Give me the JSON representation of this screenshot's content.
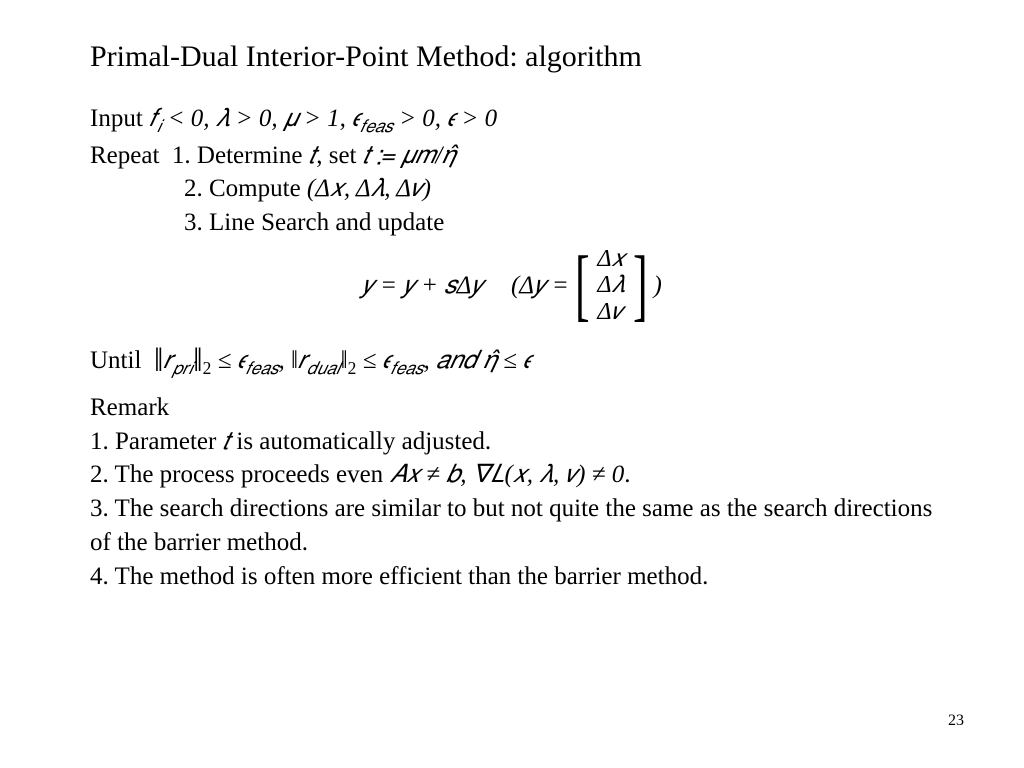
{
  "title": "Primal-Dual Interior-Point Method: algorithm",
  "input_label": "Input",
  "input_math": "𝑓<sub class='sub'>𝑖</sub> &lt; 0, 𝜆 &gt; 0, 𝜇 &gt; 1, 𝜖<sub class='sub'>𝑓𝑒𝑎𝑠</sub> &gt; 0, 𝜖 &gt; 0",
  "repeat_label": "Repeat",
  "step1_pre": "1. Determine ",
  "step1_mid": ", set ",
  "step1_t": "𝑡",
  "step1_assign": "𝑡 ≔ 𝜇𝑚/𝜂̂",
  "step2": "2. Compute (Δ𝑥, Δ𝜆, Δ𝑣)",
  "step3": "3. Line Search and update",
  "eq_left": "𝑦 = 𝑦 + 𝑠Δ𝑦",
  "eq_gap": "   ",
  "eq_right_open": "(Δ𝑦 =",
  "eq_right_close": ")",
  "vec1": "Δ𝑥",
  "vec2": "Δ𝜆",
  "vec3": "Δ𝑣",
  "until_label": "Until",
  "until_math": "<span class='bignorm'>‖</span>𝑟<sub class='sub'>𝑝𝑟𝑖</sub><span class='bignorm'>‖</span><sub class='sub' style='font-style:normal'>2</sub> ≤ 𝜖<sub class='sub'>𝑓𝑒𝑎𝑠</sub>, <span class='norm'>‖</span>𝑟<sub class='sub'>𝑑𝑢𝑎𝑙</sub><span class='norm'>‖</span><sub class='sub' style='font-style:normal'>2</sub> ≤ 𝜖<sub class='sub'>𝑓𝑒𝑎𝑠</sub>, 𝑎𝑛𝑑  𝜂̂ ≤ 𝜖",
  "remark_label": "Remark",
  "remark1_pre": "1.  Parameter ",
  "remark1_t": "𝑡",
  "remark1_post": " is automatically adjusted.",
  "remark2_pre": "2. The process proceeds even ",
  "remark2_math": "𝐴𝑥 ≠ 𝑏, ∇𝐿(𝑥, 𝜆, 𝑣) ≠ 0",
  "remark2_post": ".",
  "remark3": "3. The search directions are similar to but not quite the same as the search directions of the barrier method.",
  "remark4": "4. The method is often more efficient than the barrier method.",
  "page_number": "23"
}
